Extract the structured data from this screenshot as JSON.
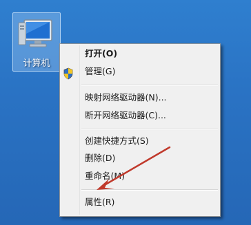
{
  "desktop": {
    "computer_icon": {
      "label": "计算机",
      "icon": "computer-icon"
    }
  },
  "context_menu": {
    "items": [
      {
        "label": "打开(O)",
        "bold": true
      },
      {
        "label": "管理(G)",
        "icon": "uac-shield-icon"
      },
      {
        "label": "映射网络驱动器(N)..."
      },
      {
        "label": "断开网络驱动器(C)..."
      },
      {
        "label": "创建快捷方式(S)"
      },
      {
        "label": "删除(D)"
      },
      {
        "label": "重命名(M)"
      },
      {
        "label": "属性(R)"
      }
    ]
  },
  "annotation": {
    "arrow_color": "#c0392b",
    "icon": "red-arrow-annotation"
  },
  "colors": {
    "desktop_blue": "#2a73c4",
    "menu_background": "#f0f0f0"
  }
}
